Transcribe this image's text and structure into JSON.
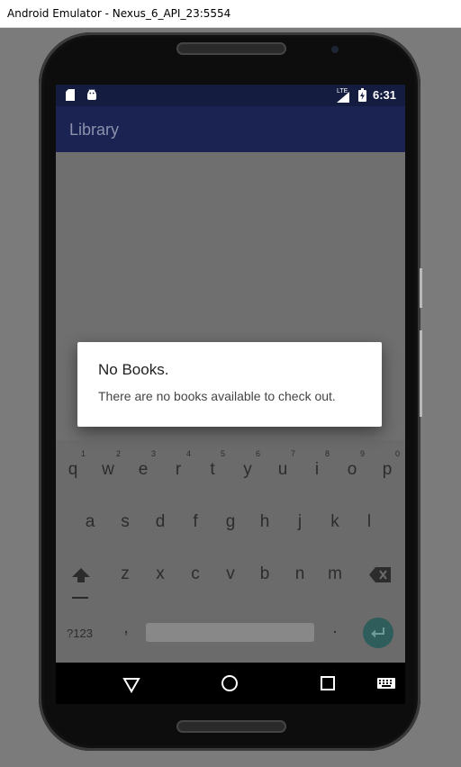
{
  "window": {
    "title": "Android Emulator - Nexus_6_API_23:5554"
  },
  "status_bar": {
    "time": "6:31",
    "network": "LTE"
  },
  "app_bar": {
    "title": "Library"
  },
  "dialog": {
    "title": "No Books.",
    "message": "There are no books available to check out."
  },
  "keyboard": {
    "row1": [
      "q",
      "w",
      "e",
      "r",
      "t",
      "y",
      "u",
      "i",
      "o",
      "p"
    ],
    "row1_hints": [
      "1",
      "2",
      "3",
      "4",
      "5",
      "6",
      "7",
      "8",
      "9",
      "0"
    ],
    "row2": [
      "a",
      "s",
      "d",
      "f",
      "g",
      "h",
      "j",
      "k",
      "l"
    ],
    "row3": [
      "z",
      "x",
      "c",
      "v",
      "b",
      "n",
      "m"
    ],
    "symbols_key": "?123",
    "comma": ",",
    "period": "."
  },
  "icons": {
    "status_left": [
      "sd-card-icon",
      "android-icon"
    ],
    "status_right": [
      "signal-icon",
      "battery-charging-icon"
    ],
    "nav": [
      "back-icon",
      "home-icon",
      "recents-icon",
      "keyboard-icon"
    ]
  },
  "colors": {
    "status_bar": "#141c40",
    "app_bar": "#1a2351",
    "enter_key": "#2e5d5c"
  }
}
